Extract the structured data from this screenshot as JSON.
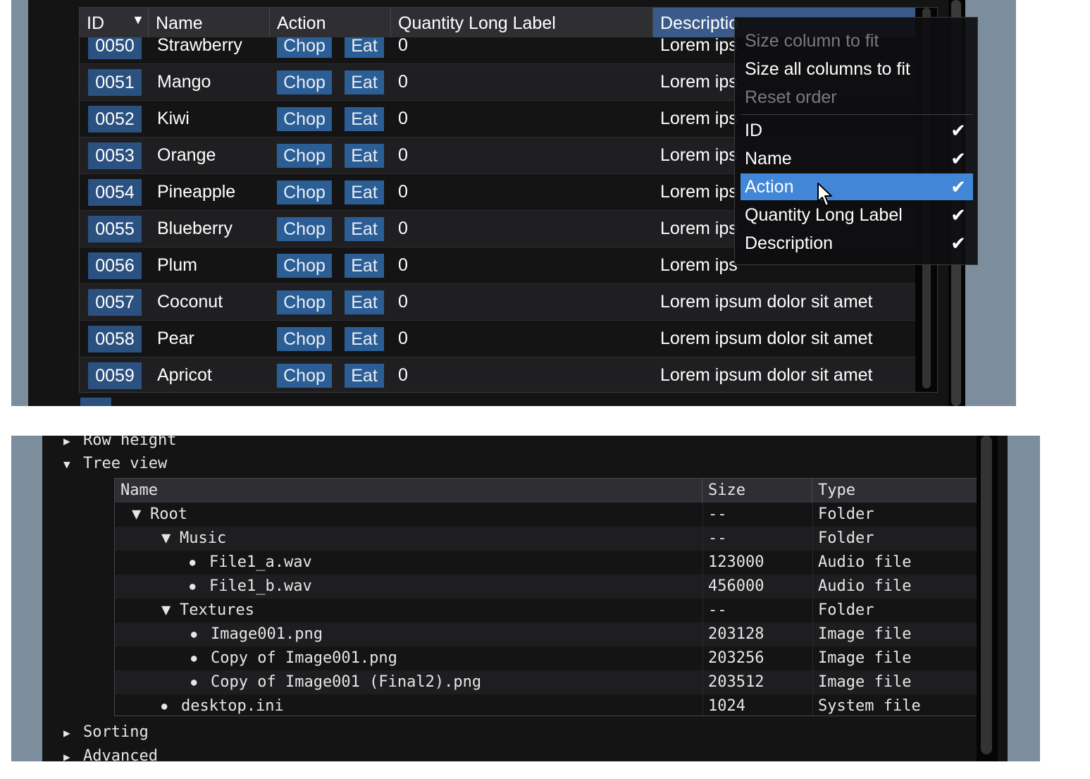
{
  "top_table": {
    "columns": [
      {
        "label": "ID",
        "sort_arrow": "▼"
      },
      {
        "label": "Name"
      },
      {
        "label": "Action"
      },
      {
        "label": "Quantity Long Label"
      },
      {
        "label": "Descriptio"
      }
    ],
    "rows": [
      {
        "id": "0050",
        "name": "Strawberry",
        "chop": "Chop",
        "eat": "Eat",
        "qty": "0",
        "desc": "Lorem ips"
      },
      {
        "id": "0051",
        "name": "Mango",
        "chop": "Chop",
        "eat": "Eat",
        "qty": "0",
        "desc": "Lorem ips"
      },
      {
        "id": "0052",
        "name": "Kiwi",
        "chop": "Chop",
        "eat": "Eat",
        "qty": "0",
        "desc": "Lorem ips"
      },
      {
        "id": "0053",
        "name": "Orange",
        "chop": "Chop",
        "eat": "Eat",
        "qty": "0",
        "desc": "Lorem ips"
      },
      {
        "id": "0054",
        "name": "Pineapple",
        "chop": "Chop",
        "eat": "Eat",
        "qty": "0",
        "desc": "Lorem ips"
      },
      {
        "id": "0055",
        "name": "Blueberry",
        "chop": "Chop",
        "eat": "Eat",
        "qty": "0",
        "desc": "Lorem ips"
      },
      {
        "id": "0056",
        "name": "Plum",
        "chop": "Chop",
        "eat": "Eat",
        "qty": "0",
        "desc": "Lorem ips"
      },
      {
        "id": "0057",
        "name": "Coconut",
        "chop": "Chop",
        "eat": "Eat",
        "qty": "0",
        "desc": "Lorem ipsum dolor sit amet"
      },
      {
        "id": "0058",
        "name": "Pear",
        "chop": "Chop",
        "eat": "Eat",
        "qty": "0",
        "desc": "Lorem ipsum dolor sit amet"
      },
      {
        "id": "0059",
        "name": "Apricot",
        "chop": "Chop",
        "eat": "Eat",
        "qty": "0",
        "desc": "Lorem ipsum dolor sit amet"
      }
    ]
  },
  "context_menu": {
    "size_column": "Size column to fit",
    "size_all": "Size all columns to fit",
    "reset_order": "Reset order",
    "columns": [
      {
        "label": "ID",
        "checked": true
      },
      {
        "label": "Name",
        "checked": true
      },
      {
        "label": "Action",
        "checked": true,
        "hovered": true
      },
      {
        "label": "Quantity Long Label",
        "checked": true
      },
      {
        "label": "Description",
        "checked": true
      }
    ],
    "check_glyph": "✔"
  },
  "bottom": {
    "row_height": "Row height",
    "tree_view": "Tree view",
    "sorting": "Sorting",
    "advanced": "Advanced",
    "collapsed_arrow": "▶",
    "expanded_arrow": "▼",
    "bullet": "●",
    "tree_columns": [
      "Name",
      "Size",
      "Type"
    ],
    "tree_rows": [
      {
        "name": "Root",
        "size": "--",
        "type": "Folder",
        "kind": "open"
      },
      {
        "name": "Music",
        "size": "--",
        "type": "Folder",
        "kind": "open"
      },
      {
        "name": "File1_a.wav",
        "size": "123000",
        "type": "Audio file",
        "kind": "leaf"
      },
      {
        "name": "File1_b.wav",
        "size": "456000",
        "type": "Audio file",
        "kind": "leaf"
      },
      {
        "name": "Textures",
        "size": "--",
        "type": "Folder",
        "kind": "open"
      },
      {
        "name": "Image001.png",
        "size": "203128",
        "type": "Image file",
        "kind": "leaf"
      },
      {
        "name": "Copy of Image001.png",
        "size": "203256",
        "type": "Image file",
        "kind": "leaf"
      },
      {
        "name": "Copy of Image001 (Final2).png",
        "size": "203512",
        "type": "Image file",
        "kind": "leaf"
      },
      {
        "name": "desktop.ini",
        "size": "1024",
        "type": "System file",
        "kind": "leaf"
      }
    ]
  },
  "colors": {
    "panel_bg": "#7c8e9d",
    "window_bg": "#141414",
    "header_bg": "#2f2f33",
    "accent_button": "#2c5e96",
    "id_cell": "#2b5180",
    "menu_highlight": "#4286d8"
  }
}
